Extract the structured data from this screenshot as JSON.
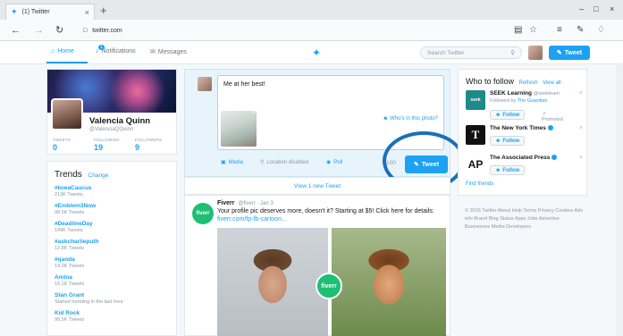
{
  "browser": {
    "tab_title": "(1) Twitter",
    "tab_close": "×",
    "new_tab": "+",
    "window_minimize": "–",
    "window_maximize": "□",
    "window_close": "×",
    "back": "←",
    "forward": "→",
    "reload": "↻",
    "url": "twitter.com"
  },
  "nav": {
    "home": "Home",
    "notifications": "Notifications",
    "notifications_badge": "1",
    "messages": "Messages",
    "search_placeholder": "Search Twitter",
    "tweet_button": "Tweet"
  },
  "profile": {
    "name": "Valencia Quinn",
    "handle": "@ValenciaQQuinn",
    "stats": [
      {
        "label": "TWEETS",
        "value": "0"
      },
      {
        "label": "FOLLOWING",
        "value": "19"
      },
      {
        "label": "FOLLOWERS",
        "value": "9"
      }
    ]
  },
  "trends": {
    "title": "Trends",
    "change": "Change",
    "items": [
      {
        "tag": "#IowaCaucus",
        "count": "213K Tweets"
      },
      {
        "tag": "#Emblem3Now",
        "count": "98.5K Tweets"
      },
      {
        "tag": "#DeadlineDay",
        "count": "149K Tweets"
      },
      {
        "tag": "#askcharlieputh",
        "count": "12.8K Tweets"
      },
      {
        "tag": "#qanda",
        "count": "19.2K Tweets"
      },
      {
        "tag": "Amina",
        "count": "16.1K Tweets"
      },
      {
        "tag": "Stan Grant",
        "count": "Started trending in the last hour"
      },
      {
        "tag": "Kid Rock",
        "count": "98.5K Tweets"
      }
    ]
  },
  "compose": {
    "text": "Me at her best!",
    "who_in_photo": "Who's in this photo?",
    "media": "Media",
    "location": "Location disabled",
    "poll": "Poll",
    "char_count": "100",
    "tweet_button": "Tweet"
  },
  "new_tweets_bar": "View 1 new Tweet",
  "tweet": {
    "avatar_text": "fiverr",
    "author": "Fiverr",
    "handle_time": "@fiverr · Jan 3",
    "text": "Your profile pic deserves more, doesn't it? Starting at $5! Click here for details:",
    "link": "fiverr.com/fp-fb-cartoon...",
    "badge": "fiverr"
  },
  "who_to_follow": {
    "title": "Who to follow",
    "refresh": "Refresh",
    "view_all": "View all",
    "suggestions": [
      {
        "name": "SEEK Learning",
        "handle": "@seeklearn",
        "sub_prefix": "Followed by",
        "sub_link": "The Guardian",
        "follow": "Follow",
        "promoted": "Promoted",
        "avatar_text": "seek",
        "avatar_color": "#1e8a8a"
      },
      {
        "name": "The New York Times",
        "follow": "Follow",
        "avatar_text": "T",
        "avatar_color": "#111111"
      },
      {
        "name": "The Associated Press",
        "follow": "Follow",
        "avatar_text": "AP",
        "avatar_color": "#ffffff"
      }
    ],
    "find_friends": "Find friends"
  },
  "footer": "© 2016 Twitter  About  Help  Terms  Privacy  Cookies  Ads info  Brand  Blog  Status  Apps  Jobs  Advertise  Businesses  Media  Developers"
}
